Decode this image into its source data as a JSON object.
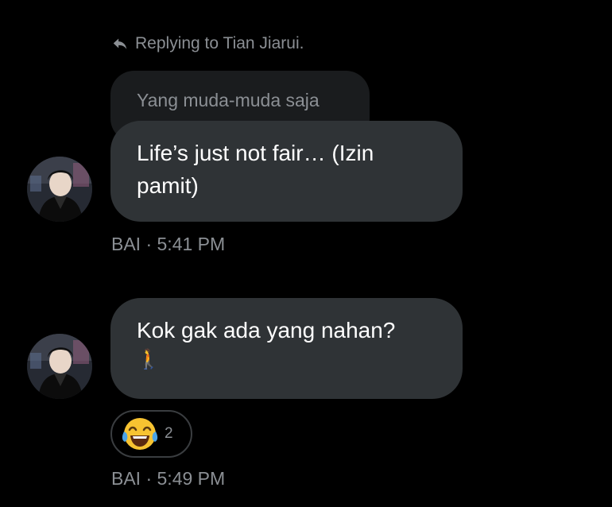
{
  "reply_context": {
    "icon": "reply-arrow-icon",
    "text": "Replying to Tian Jiarui."
  },
  "quoted_message": {
    "text": "Yang muda-muda saja"
  },
  "messages": [
    {
      "text": "Life’s just not fair… (Izin pamit)",
      "sender": "BAI",
      "time": "5:41 PM",
      "meta": "BAI · 5:41 PM"
    },
    {
      "text": "Kok gak ada yang nahan?",
      "emoji": "🚶",
      "sender": "BAI",
      "time": "5:49 PM",
      "meta": "BAI · 5:49 PM",
      "reaction": {
        "emoji": "😂",
        "icon": "face-with-tears-of-joy-icon",
        "count": "2"
      }
    }
  ],
  "colors": {
    "background": "#000000",
    "bubble": "#2f3336",
    "quoted_bubble": "#1a1c1e",
    "muted_text": "#8b8f94",
    "primary_text": "#ffffff"
  }
}
